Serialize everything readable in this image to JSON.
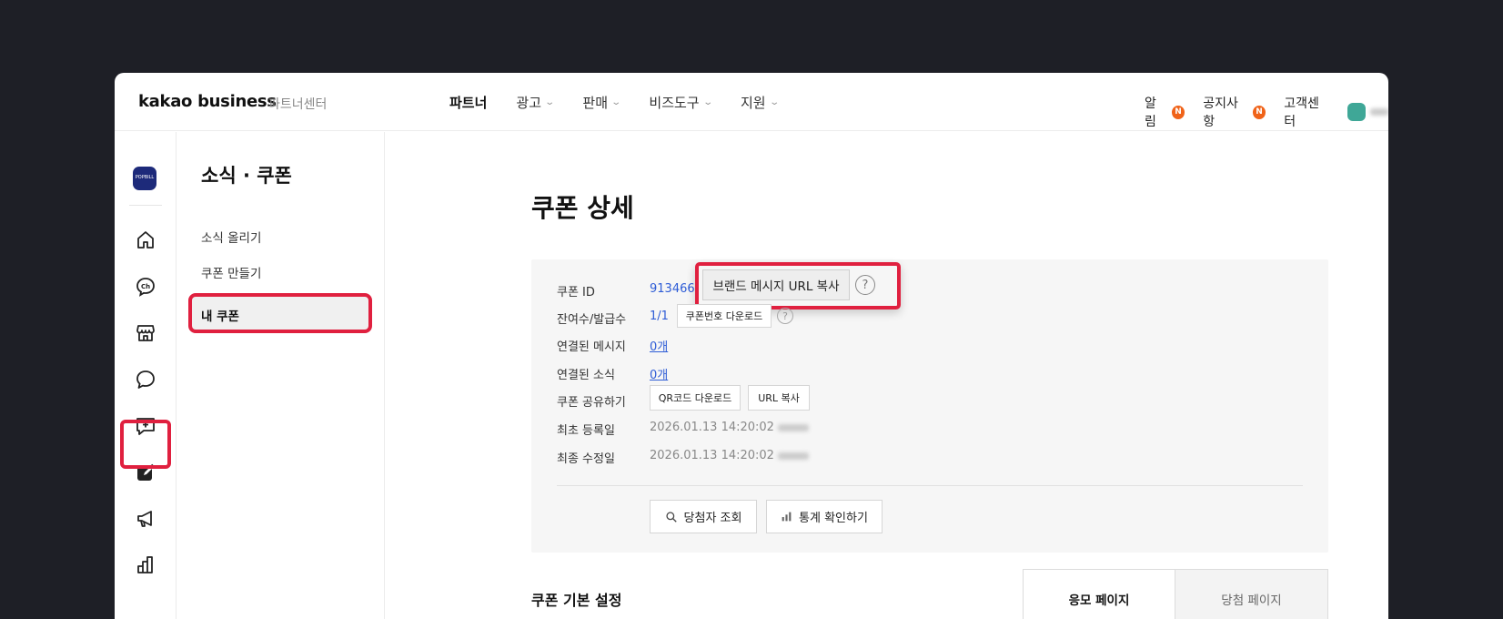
{
  "topbar": {
    "logo": "kakao business",
    "logo_sub": "파트너센터",
    "gnb": [
      {
        "label": "파트너",
        "dropdown": false
      },
      {
        "label": "광고",
        "dropdown": true
      },
      {
        "label": "판매",
        "dropdown": true
      },
      {
        "label": "비즈도구",
        "dropdown": true
      },
      {
        "label": "지원",
        "dropdown": true
      }
    ],
    "alarm": "알림",
    "notice": "공지사항",
    "new_badge": "N",
    "support": "고객센터"
  },
  "rail": {
    "brand_badge": "POPBILL",
    "icons": [
      "home-icon",
      "channel-icon",
      "store-icon",
      "chat-icon",
      "message-add-icon",
      "edit-icon",
      "megaphone-icon",
      "stats-icon"
    ]
  },
  "subnav": {
    "title": "소식 · 쿠폰",
    "items": [
      "소식 올리기",
      "쿠폰 만들기",
      "내 쿠폰"
    ]
  },
  "main": {
    "page_title": "쿠폰 상세",
    "rows": {
      "coupon_id_label": "쿠폰 ID",
      "coupon_id": "913466",
      "brand_msg_copy": "브랜드 메시지 URL 복사",
      "remain_label": "잔여수/발급수",
      "remain_value": "1/1",
      "coupon_no_download": "쿠폰번호 다운로드",
      "linked_msg_label": "연결된 메시지",
      "linked_msg_value": "0개",
      "linked_news_label": "연결된 소식",
      "linked_news_value": "0개",
      "share_label": "쿠폰 공유하기",
      "qr_download": "QR코드 다운로드",
      "url_copy": "URL 복사",
      "created_label": "최초 등록일",
      "created_value": "2026.01.13 14:20:02",
      "modified_label": "최종 수정일",
      "modified_value": "2026.01.13 14:20:02",
      "question_mark": "?"
    },
    "actions": {
      "winner_lookup": "당첨자 조회",
      "stats": "통계 확인하기"
    },
    "section_title": "쿠폰 기본 설정",
    "tabs": [
      "응모 페이지",
      "당첨 페이지"
    ]
  },
  "colors": {
    "highlight": "#e0203f",
    "link": "#2e5cd6",
    "badge": "#f06319"
  }
}
